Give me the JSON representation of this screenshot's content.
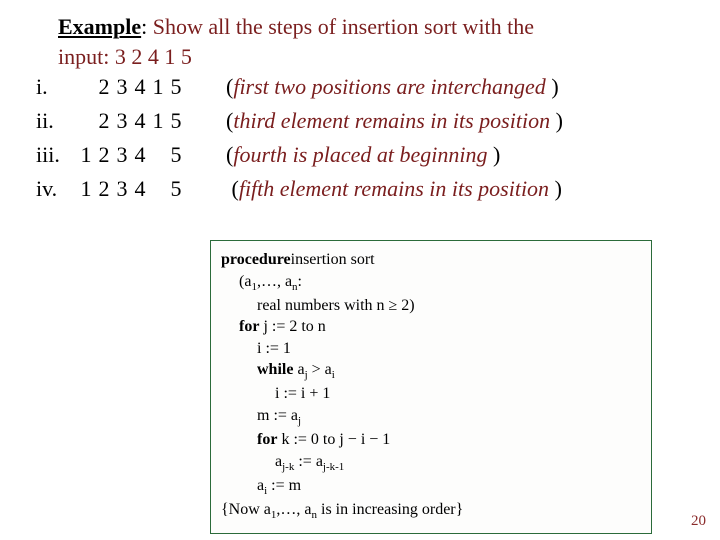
{
  "title": {
    "label": "Example",
    "colon": ":",
    "text1": "Show all the steps of  insertion sort with the",
    "text2": "input:  3  2  4  1  5"
  },
  "steps": [
    {
      "rn": "i.",
      "d": [
        "",
        "2",
        "3",
        "4",
        "1",
        "5"
      ],
      "note": "first two positions are interchanged"
    },
    {
      "rn": "ii.",
      "d": [
        "",
        "2",
        "3",
        "4",
        "1",
        "5"
      ],
      "note": "third element remains in its position"
    },
    {
      "rn": "iii.",
      "d": [
        "1",
        "2",
        "3",
        "4",
        "",
        "5"
      ],
      "note": "fourth is placed at beginning"
    },
    {
      "rn": "iv.",
      "d": [
        "1",
        "2",
        "3",
        "4",
        "",
        "5"
      ],
      "note": "fifth  element remains in its position"
    }
  ],
  "code": {
    "l1a": "procedure",
    "l1b": "insertion sort",
    "l2": "(a",
    "l2sub": "1",
    "l2b": ",…, a",
    "l2sub2": "n",
    "l2c": ":",
    "l3": "real numbers with n ≥ 2)",
    "l4a": "for",
    "l4b": " j := 2 to n",
    "l5": "i := 1",
    "l6a": "while",
    "l6b": " a",
    "l6sub1": "j",
    "l6c": " > a",
    "l6sub2": "i",
    "l7": "i := i + 1",
    "l8": "m := a",
    "l8sub": "j",
    "l9a": "for",
    "l9b": " k := 0 to j  −  i − 1",
    "l10a": "a",
    "l10sub1": "j-k",
    "l10b": " := a",
    "l10sub2": "j-k-1",
    "l11a": "a",
    "l11sub": "i",
    "l11b": " := m",
    "l12a": "{Now a",
    "l12sub1": "1",
    "l12b": ",…, a",
    "l12sub2": "n",
    "l12c": " is in increasing order}"
  },
  "page": "20"
}
